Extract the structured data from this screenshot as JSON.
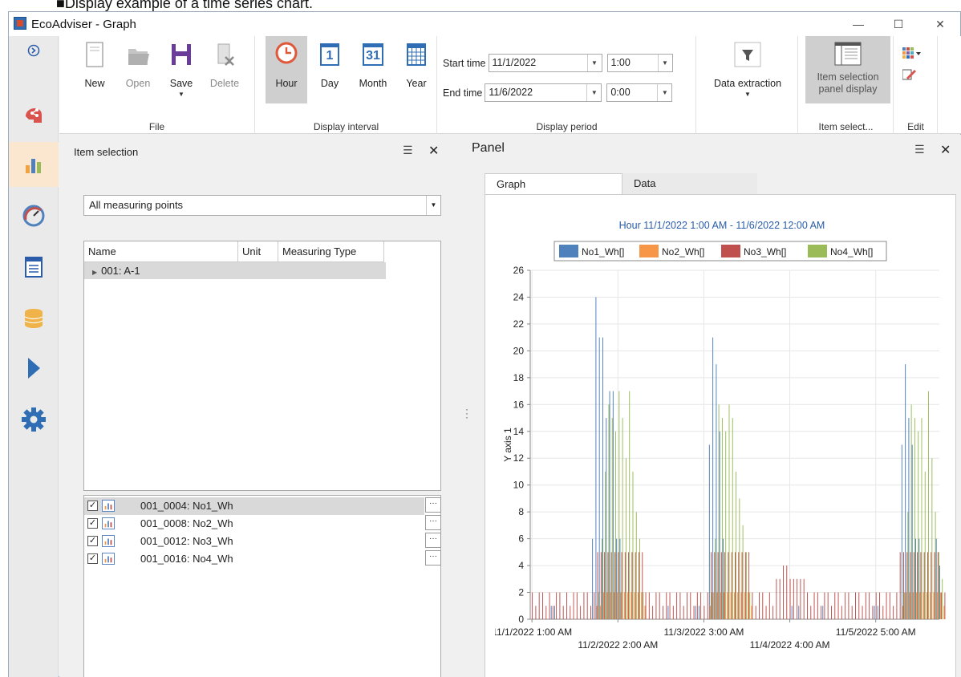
{
  "caption": "■Display example of a time series chart.",
  "window": {
    "title": "EcoAdviser - Graph",
    "controls": {
      "minimize": "—",
      "maximize": "☐",
      "close": "✕"
    }
  },
  "sidebar": {
    "items": [
      {
        "icon": "expand-arrow-icon"
      },
      {
        "icon": "graph-app-icon"
      },
      {
        "icon": "bar-chart-icon",
        "active": true
      },
      {
        "icon": "gauge-icon"
      },
      {
        "icon": "report-icon"
      },
      {
        "icon": "database-icon"
      },
      {
        "icon": "play-icon"
      },
      {
        "icon": "settings-gear-icon"
      }
    ]
  },
  "ribbon": {
    "file": {
      "label": "File",
      "new": "New",
      "open": "Open",
      "save": "Save",
      "delete": "Delete"
    },
    "interval": {
      "label": "Display interval",
      "hour": "Hour",
      "day": "Day",
      "month": "Month",
      "year": "Year",
      "day_num": "1",
      "month_num": "31"
    },
    "period": {
      "label": "Display period",
      "start_label": "Start time",
      "start_date": "11/1/2022",
      "start_time": "1:00",
      "end_label": "End time",
      "end_date": "11/6/2022",
      "end_time": "0:00",
      "extraction": "Data extraction"
    },
    "itemsel": {
      "label": "Item select...",
      "btn_line1": "Item selection",
      "btn_line2": "panel display"
    },
    "edit": {
      "label": "Edit"
    }
  },
  "item_panel": {
    "title": "Item selection",
    "filter": "All measuring points",
    "columns": [
      "Name",
      "Unit",
      "Measuring Type"
    ],
    "tree_node": "001: A-1",
    "items": [
      "001_0004: No1_Wh",
      "001_0008: No2_Wh",
      "001_0012: No3_Wh",
      "001_0016: No4_Wh"
    ],
    "more": "···",
    "check": "✓"
  },
  "graph_panel": {
    "title": "Panel",
    "tabs": [
      "Graph",
      "Data"
    ]
  },
  "chart_data": {
    "type": "bar",
    "title": "Hour 11/1/2022 1:00 AM - 11/6/2022 12:00 AM",
    "ylabel": "Y axis 1",
    "xlabel": "",
    "ylim": [
      0,
      26
    ],
    "yticks": [
      0,
      2,
      4,
      6,
      8,
      10,
      12,
      14,
      16,
      18,
      20,
      22,
      24,
      26
    ],
    "xtick_labels_row1": [
      "11/1/2022 1:00 AM",
      "11/3/2022 3:00 AM",
      "11/5/2022 5:00 AM"
    ],
    "xtick_labels_row2": [
      "11/2/2022 2:00 AM",
      "11/4/2022 4:00 AM"
    ],
    "hours": 119,
    "legend_position": "top",
    "grid": true,
    "series": [
      {
        "name": "No1_Wh[]",
        "color": "#4f81bd",
        "values": [
          0,
          0,
          0,
          0,
          0,
          0,
          1,
          1,
          0,
          0,
          0,
          0,
          0,
          0,
          0,
          0,
          0,
          0,
          6,
          24,
          21,
          21,
          15,
          17,
          17,
          6,
          6,
          0,
          0,
          0,
          0,
          0,
          0,
          0,
          0,
          0,
          0,
          0,
          0,
          0,
          1,
          0,
          0,
          0,
          0,
          0,
          0,
          0,
          1,
          1,
          0,
          0,
          13,
          21,
          19,
          14,
          6,
          0,
          0,
          0,
          0,
          0,
          0,
          0,
          0,
          0,
          0,
          0,
          0,
          0,
          0,
          0,
          0,
          0,
          0,
          0,
          1,
          0,
          1,
          0,
          0,
          0,
          0,
          0,
          0,
          1,
          0,
          0,
          0,
          0,
          0,
          0,
          0,
          0,
          0,
          0,
          0,
          0,
          0,
          0,
          1,
          1,
          0,
          0,
          0,
          0,
          0,
          0,
          13,
          19,
          15,
          13,
          6,
          6,
          0,
          0,
          0,
          0,
          6,
          4,
          0
        ]
      },
      {
        "name": "No2_Wh[]",
        "color": "#f79646",
        "values": [
          0,
          0,
          0,
          0,
          0,
          0,
          0,
          0,
          0,
          0,
          0,
          0,
          0,
          0,
          0,
          0,
          0,
          0,
          0,
          1,
          1,
          2,
          2,
          2,
          2,
          2,
          2,
          2,
          2,
          2,
          2,
          2,
          2,
          1,
          0,
          0,
          0,
          0,
          0,
          0,
          0,
          0,
          0,
          0,
          0,
          0,
          0,
          0,
          0,
          0,
          0,
          0,
          1,
          2,
          2,
          2,
          2,
          2,
          2,
          2,
          2,
          2,
          2,
          2,
          1,
          0,
          0,
          0,
          0,
          0,
          0,
          0,
          0,
          0,
          0,
          0,
          0,
          0,
          0,
          0,
          0,
          0,
          0,
          0,
          0,
          0,
          0,
          0,
          0,
          0,
          0,
          0,
          0,
          0,
          0,
          0,
          0,
          0,
          0,
          0,
          0,
          0,
          0,
          0,
          0,
          0,
          0,
          0,
          1,
          2,
          2,
          2,
          2,
          2,
          2,
          2,
          2,
          2,
          2,
          2,
          1
        ]
      },
      {
        "name": "No3_Wh[]",
        "color": "#c0504d",
        "values": [
          2,
          1,
          2,
          2,
          1,
          2,
          1,
          2,
          2,
          1,
          2,
          1,
          2,
          2,
          1,
          2,
          2,
          1,
          2,
          5,
          5,
          5,
          5,
          5,
          5,
          5,
          5,
          5,
          5,
          5,
          5,
          5,
          5,
          2,
          2,
          1,
          2,
          2,
          1,
          2,
          2,
          1,
          2,
          2,
          1,
          2,
          2,
          1,
          2,
          2,
          1,
          2,
          5,
          5,
          5,
          5,
          5,
          5,
          5,
          5,
          5,
          5,
          5,
          5,
          2,
          1,
          2,
          2,
          1,
          2,
          1,
          3,
          3,
          4,
          4,
          3,
          3,
          3,
          3,
          3,
          2,
          1,
          2,
          2,
          1,
          2,
          2,
          1,
          2,
          2,
          1,
          2,
          2,
          1,
          2,
          2,
          1,
          2,
          2,
          1,
          2,
          2,
          1,
          2,
          2,
          1,
          2,
          5,
          5,
          5,
          5,
          5,
          5,
          5,
          5,
          5,
          5,
          5,
          5,
          2,
          2
        ]
      },
      {
        "name": "No4_Wh[]",
        "color": "#9bbb59",
        "values": [
          0,
          0,
          0,
          0,
          0,
          0,
          0,
          0,
          0,
          0,
          0,
          0,
          0,
          0,
          0,
          0,
          0,
          0,
          0,
          2,
          6,
          11,
          16,
          15,
          14,
          17,
          15,
          12,
          17,
          11,
          8,
          6,
          2,
          0,
          0,
          0,
          0,
          0,
          0,
          0,
          0,
          0,
          0,
          0,
          0,
          0,
          0,
          0,
          0,
          0,
          0,
          0,
          2,
          6,
          16,
          15,
          14,
          16,
          15,
          11,
          9,
          7,
          5,
          2,
          0,
          0,
          0,
          0,
          0,
          0,
          0,
          0,
          0,
          0,
          0,
          0,
          0,
          0,
          0,
          0,
          0,
          0,
          0,
          0,
          0,
          0,
          0,
          0,
          0,
          0,
          0,
          0,
          0,
          0,
          0,
          0,
          0,
          0,
          0,
          0,
          0,
          0,
          0,
          0,
          0,
          0,
          0,
          0,
          2,
          8,
          16,
          15,
          14,
          15,
          11,
          17,
          12,
          8,
          5,
          3,
          0
        ]
      }
    ]
  }
}
